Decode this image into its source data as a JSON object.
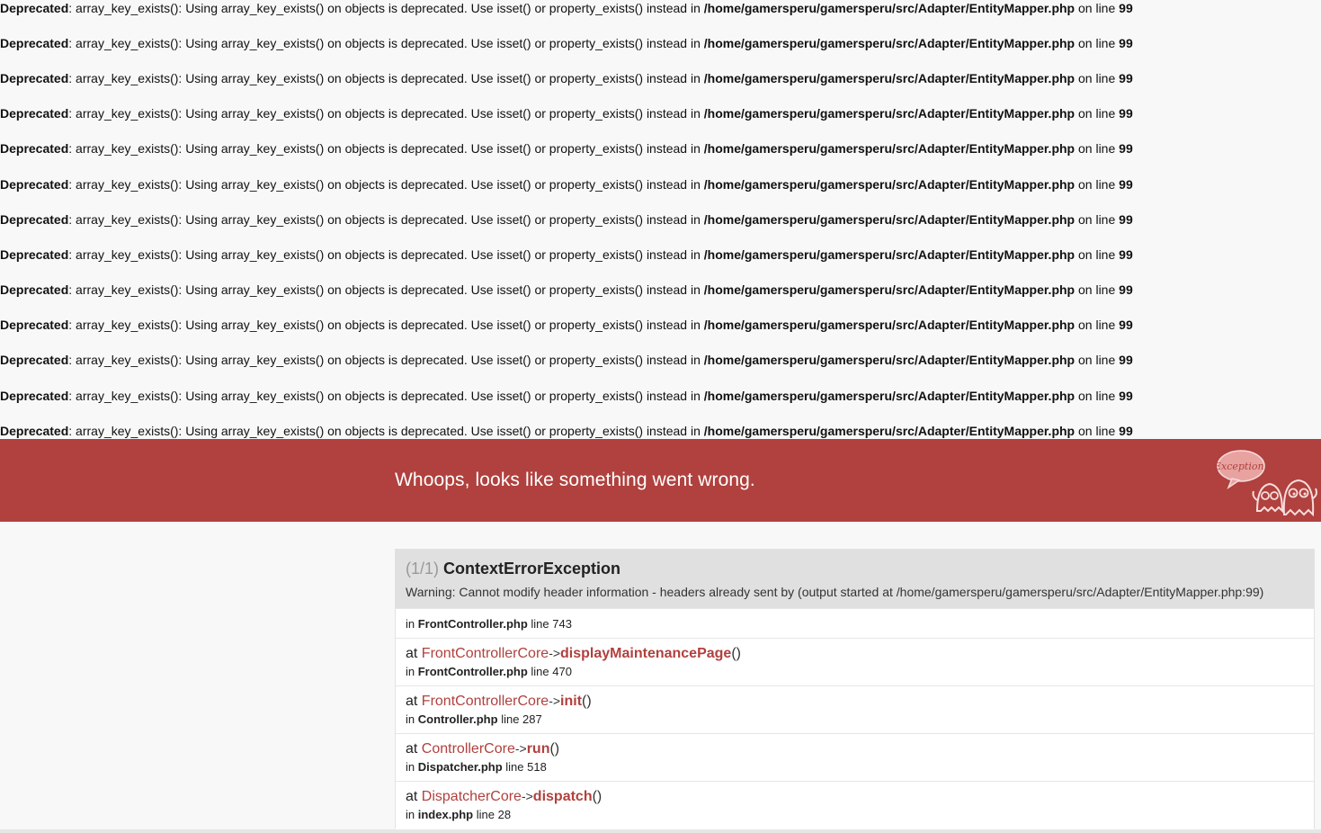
{
  "deprecations": {
    "label": "Deprecated",
    "message": ": array_key_exists(): Using array_key_exists() on objects is deprecated. Use isset() or property_exists() instead in ",
    "file": "/home/gamersperu/gamersperu/src/Adapter/EntityMapper.php",
    "on_line_text": " on line ",
    "line": "99",
    "count": 13
  },
  "header": {
    "title": "Whoops, looks like something went wrong.",
    "logo_text": "Exception!",
    "bg_color": "#b0413e"
  },
  "exception": {
    "counter": "(1/1)",
    "name": "ContextErrorException",
    "message": "Warning: Cannot modify header information - headers already sent by (output started at /home/gamersperu/gamersperu/src/Adapter/EntityMapper.php:99)",
    "origin": {
      "in_text": "in ",
      "file": "FrontController.php",
      "line_text": " line 743"
    }
  },
  "trace": [
    {
      "at": "at ",
      "class": "FrontControllerCore",
      "arrow": "->",
      "function": "displayMaintenancePage",
      "parens": "()",
      "in_text": "in ",
      "file": "FrontController.php",
      "line_text": " line 470"
    },
    {
      "at": "at ",
      "class": "FrontControllerCore",
      "arrow": "->",
      "function": "init",
      "parens": "()",
      "in_text": "in ",
      "file": "Controller.php",
      "line_text": " line 287"
    },
    {
      "at": "at ",
      "class": "ControllerCore",
      "arrow": "->",
      "function": "run",
      "parens": "()",
      "in_text": "in ",
      "file": "Dispatcher.php",
      "line_text": " line 518"
    },
    {
      "at": "at ",
      "class": "DispatcherCore",
      "arrow": "->",
      "function": "dispatch",
      "parens": "()",
      "in_text": "in ",
      "file": "index.php",
      "line_text": " line 28"
    }
  ]
}
